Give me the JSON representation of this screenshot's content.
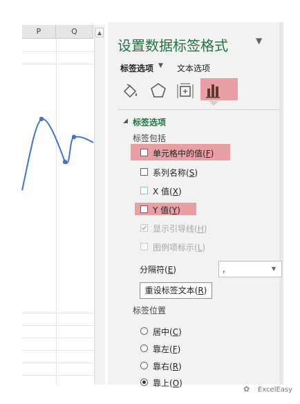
{
  "sheet": {
    "columns": [
      "P",
      "Q"
    ],
    "series_points": [
      {
        "x": 0,
        "y": 0.72
      },
      {
        "x": 1,
        "y": 0.28
      },
      {
        "x": 2,
        "y": 0.55
      },
      {
        "x": 3,
        "y": 0.33
      }
    ]
  },
  "scrollbar": {
    "up_arrow": "▲"
  },
  "pane": {
    "title": "设置数据标签格式",
    "close_glyph": "▼",
    "tabs": [
      {
        "label": "标签选项",
        "caret": "▼",
        "active": true
      },
      {
        "label": "文本选项",
        "active": false
      }
    ],
    "icons": [
      "fill-line-icon",
      "effects-pentagon-icon",
      "size-properties-icon",
      "label-options-chart-icon"
    ],
    "section": {
      "toggle": "◢",
      "title": "标签选项"
    },
    "label_contains": {
      "heading": "标签包括",
      "options": [
        {
          "label": "单元格中的值",
          "key": "F",
          "checked": false,
          "highlighted": true,
          "disabled": false
        },
        {
          "label": "系列名称",
          "key": "S",
          "checked": false,
          "highlighted": false,
          "disabled": false
        },
        {
          "label": "X 值",
          "key": "X",
          "checked": false,
          "highlighted": false,
          "disabled": false
        },
        {
          "label": "Y 值",
          "key": "Y",
          "checked": false,
          "highlighted": true,
          "disabled": false
        },
        {
          "label": "显示引导线",
          "key": "H",
          "checked": true,
          "highlighted": false,
          "disabled": true
        },
        {
          "label": "图例项标示",
          "key": "L",
          "checked": false,
          "highlighted": false,
          "disabled": true
        }
      ]
    },
    "separator": {
      "label": "分隔符",
      "key": "E",
      "value": ","
    },
    "reset_button": {
      "label": "重设标签文本",
      "key": "R"
    },
    "label_position": {
      "heading": "标签位置",
      "options": [
        {
          "label": "居中",
          "key": "C",
          "selected": false
        },
        {
          "label": "靠左",
          "key": "F",
          "selected": false
        },
        {
          "label": "靠右",
          "key": "R",
          "selected": false
        },
        {
          "label": "靠上",
          "key": "O",
          "selected": true
        }
      ]
    }
  },
  "watermark": {
    "icon": "✿",
    "text": "ExcelEasy"
  },
  "colors": {
    "accent": "#217346",
    "highlight": "#e8a0a5",
    "line": "#4472c4"
  }
}
